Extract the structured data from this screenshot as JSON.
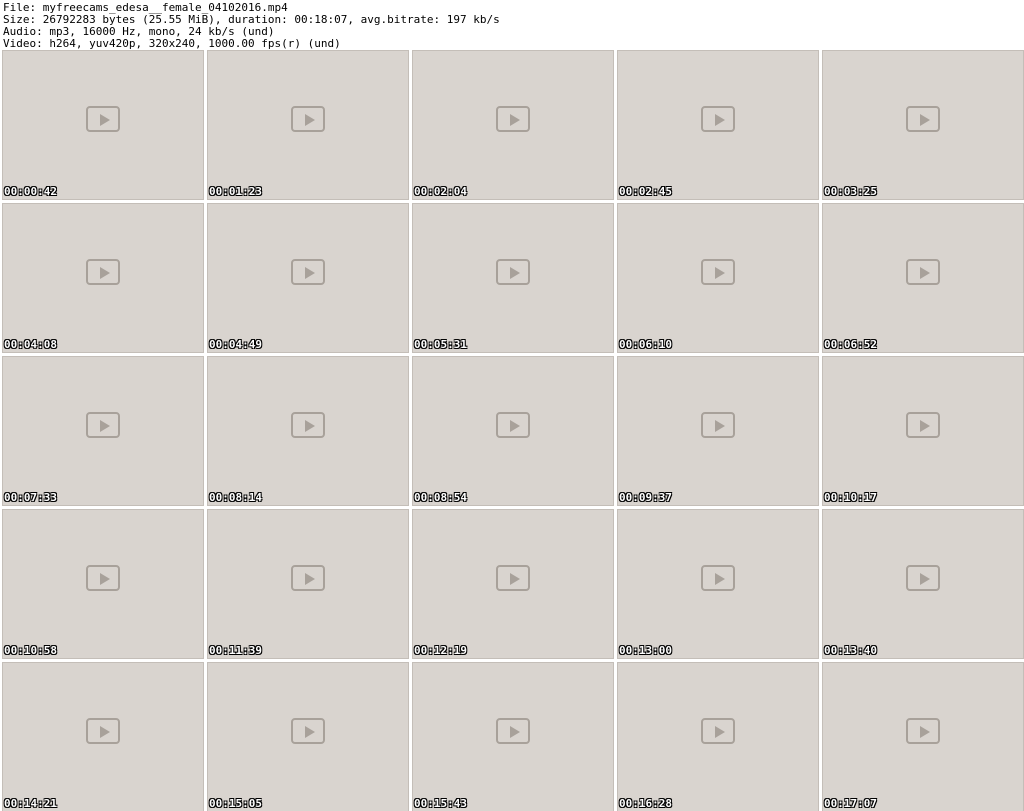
{
  "header": {
    "file": "File: myfreecams_edesa__female_04102016.mp4",
    "size": "Size: 26792283 bytes (25.55 MiB), duration: 00:18:07, avg.bitrate: 197 kb/s",
    "audio": "Audio: mp3, 16000 Hz, mono, 24 kb/s (und)",
    "video": "Video: h264, yuv420p, 320x240, 1000.00 fps(r) (und)"
  },
  "frames": [
    "00:00:42",
    "00:01:23",
    "00:02:04",
    "00:02:45",
    "00:03:25",
    "00:04:08",
    "00:04:49",
    "00:05:31",
    "00:06:10",
    "00:06:52",
    "00:07:33",
    "00:08:14",
    "00:08:54",
    "00:09:37",
    "00:10:17",
    "00:10:58",
    "00:11:39",
    "00:12:19",
    "00:13:00",
    "00:13:40",
    "00:14:21",
    "00:15:05",
    "00:15:43",
    "00:16:28",
    "00:17:07"
  ]
}
